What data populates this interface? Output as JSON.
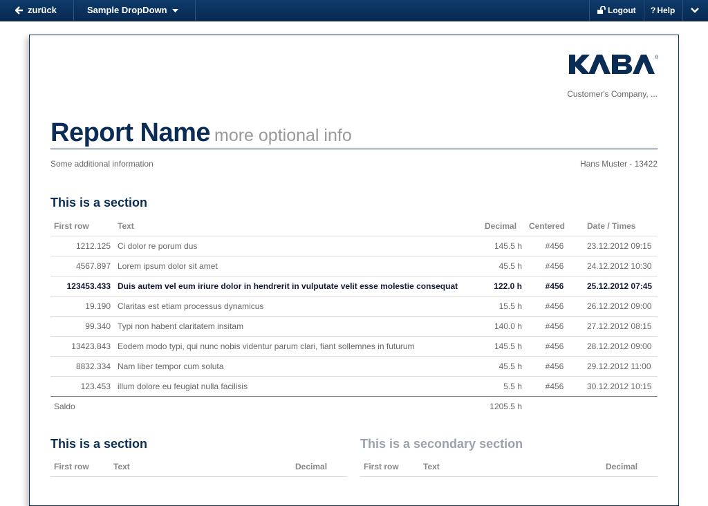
{
  "topbar": {
    "back_label": "zurück",
    "dropdown_label": "Sample DropDown",
    "logout_label": "Logout",
    "help_label": "Help"
  },
  "report": {
    "logo_text": "KABA",
    "company": "Customer's Company, ...",
    "title": "Report Name",
    "subtitle": "more optional info",
    "info_left": "Some additional information",
    "info_right": "Hans Muster - 13422",
    "section1": {
      "title": "This is a section",
      "headers": [
        "First row",
        "Text",
        "Decimal",
        "Centered",
        "Date / Times"
      ],
      "rows": [
        [
          "1212.125",
          "Ci dolor re porum dus",
          "145.5 h",
          "#456",
          "23.12.2012 09:15"
        ],
        [
          "4567.897",
          "Lorem ipsum dolor sit amet",
          "45.5 h",
          "#456",
          "24.12.2012 10:30"
        ],
        [
          "123453.433",
          "Duis autem vel eum iriure dolor in hendrerit in vulputate velit esse molestie consequat",
          "122.0 h",
          "#456",
          "25.12.2012 07:45"
        ],
        [
          "19.190",
          "Claritas est etiam processus dynamicus",
          "15.5 h",
          "#456",
          "26.12.2012 09:00"
        ],
        [
          "99.340",
          "Typi non habent claritatem insitam",
          "140.0 h",
          "#456",
          "27.12.2012 08:15"
        ],
        [
          "13423.843",
          "Eodem modo typi, qui nunc nobis videntur parum clari, fiant sollemnes in futurum",
          "145.5 h",
          "#456",
          "28.12.2012 09:00"
        ],
        [
          "8832.334",
          "Nam liber tempor cum soluta",
          "45.5 h",
          "#456",
          "29.12.2012 11:00"
        ],
        [
          "123.453",
          "illum dolore eu feugiat nulla facilisis",
          "5.5 h",
          "#456",
          "30.12.2012 10:15"
        ]
      ],
      "saldo_label": "Saldo",
      "saldo_value": "1205.5 h"
    },
    "section2": {
      "title": "This is a section",
      "headers": [
        "First row",
        "Text",
        "Decimal"
      ]
    },
    "section3": {
      "title": "This is a secondary section",
      "headers": [
        "First row",
        "Text",
        "Decimal"
      ]
    }
  }
}
